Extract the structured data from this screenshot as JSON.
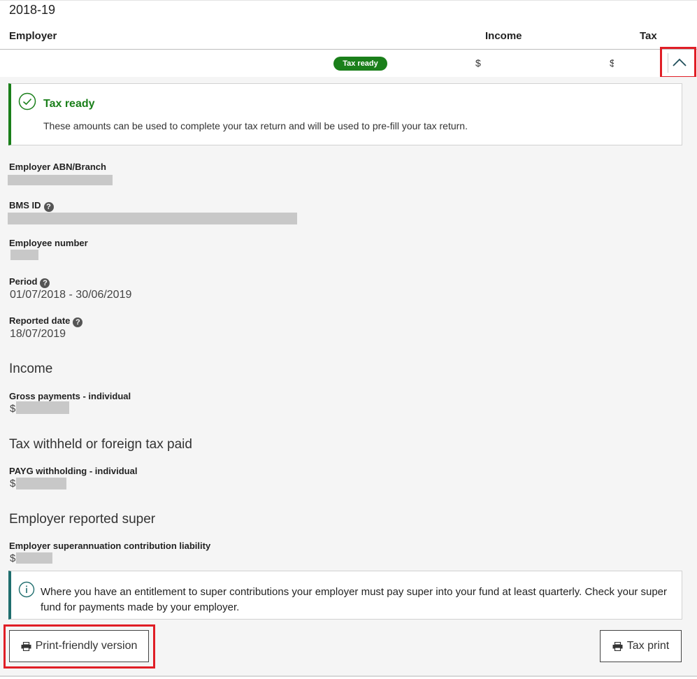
{
  "year": "2018-19",
  "table": {
    "headers": {
      "employer": "Employer",
      "income": "Income",
      "tax": "Tax"
    },
    "row": {
      "status_badge": "Tax ready",
      "income_prefix": "$",
      "tax_prefix": "$"
    }
  },
  "success_alert": {
    "title": "Tax ready",
    "text": "These amounts can be used to complete your tax return and will be used to pre-fill your tax return."
  },
  "details": {
    "abn_label": "Employer ABN/Branch",
    "bms_label": "BMS ID",
    "employee_number_label": "Employee number",
    "period_label": "Period",
    "period_value": "01/07/2018 - 30/06/2019",
    "reported_date_label": "Reported date",
    "reported_date_value": "18/07/2019",
    "help_glyph": "?"
  },
  "income": {
    "heading": "Income",
    "gross_label": "Gross payments - individual",
    "gross_prefix": "$"
  },
  "tax_withheld": {
    "heading": "Tax withheld or foreign tax paid",
    "payg_label": "PAYG withholding - individual",
    "payg_prefix": "$"
  },
  "super": {
    "heading": "Employer reported super",
    "liability_label": "Employer superannuation contribution liability",
    "liability_prefix": "$"
  },
  "info_alert": {
    "text": "Where you have an entitlement to super contributions your employer must pay super into your fund at least quarterly. Check your super fund for payments made by your employer."
  },
  "buttons": {
    "print_friendly": "Print-friendly version",
    "tax_print": "Tax print"
  },
  "colors": {
    "success": "#1a7f1a",
    "highlight": "#e01e26",
    "info": "#1f6e6e"
  },
  "icons": {
    "toggle": "chevron-up-icon",
    "success": "check-circle-icon",
    "info": "info-circle-icon",
    "print": "printer-icon",
    "help": "question-icon"
  }
}
